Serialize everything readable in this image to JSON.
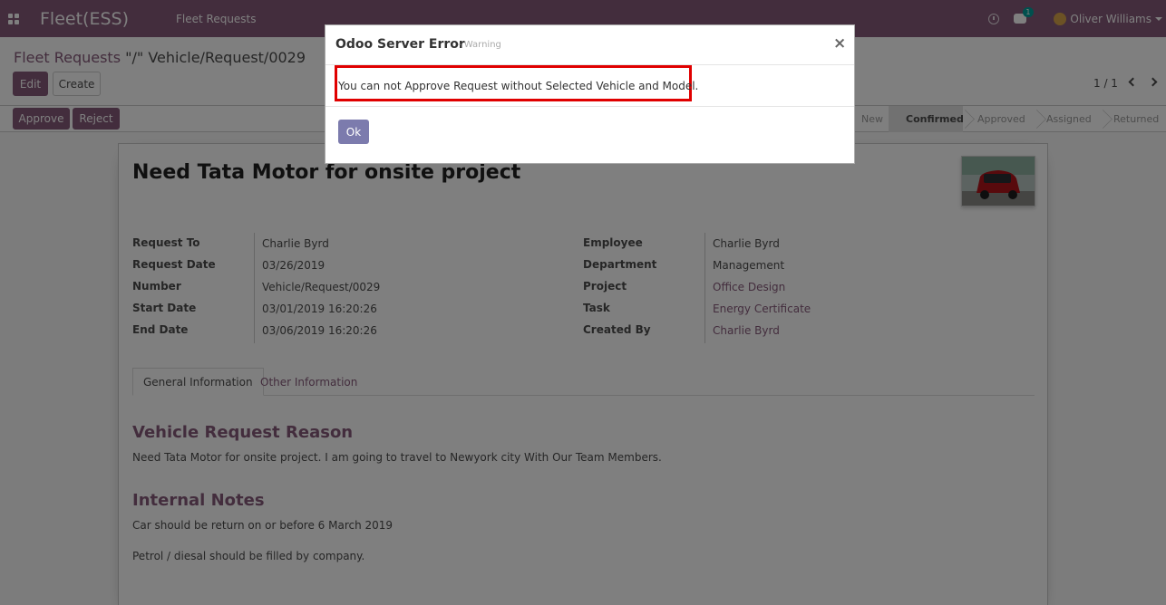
{
  "navbar": {
    "app_title": "Fleet(ESS)",
    "menu_item": "Fleet Requests",
    "chat_count": "1",
    "user_name": "Oliver Williams"
  },
  "control_panel": {
    "breadcrumb_parent": "Fleet Requests",
    "breadcrumb_separator": "\"/\"",
    "breadcrumb_current": "Vehicle/Request/0029",
    "edit_label": "Edit",
    "create_label": "Create",
    "pager": "1 / 1"
  },
  "statusbar": {
    "approve_label": "Approve",
    "reject_label": "Reject",
    "stages": [
      "New",
      "Confirmed",
      "Approved",
      "Assigned",
      "Returned"
    ],
    "active_stage": "Confirmed"
  },
  "form": {
    "title": "Need Tata Motor for onsite project",
    "left_fields": [
      {
        "label": "Request To",
        "value": "Charlie Byrd"
      },
      {
        "label": "Request Date",
        "value": "03/26/2019"
      },
      {
        "label": "Number",
        "value": "Vehicle/Request/0029"
      },
      {
        "label": "Start Date",
        "value": "03/01/2019 16:20:26"
      },
      {
        "label": "End Date",
        "value": "03/06/2019 16:20:26"
      }
    ],
    "right_fields": [
      {
        "label": "Employee",
        "value": "Charlie Byrd"
      },
      {
        "label": "Department",
        "value": "Management"
      },
      {
        "label": "Project",
        "value": "Office Design"
      },
      {
        "label": "Task",
        "value": "Energy Certificate"
      },
      {
        "label": "Created By",
        "value": "Charlie Byrd"
      }
    ],
    "tabs": [
      "General Information",
      "Other Information"
    ],
    "reason_title": "Vehicle Request Reason",
    "reason_text": "Need Tata Motor for onsite project. I am going to travel to Newyork city With Our Team Members.",
    "notes_title": "Internal Notes",
    "notes_line1": "Car should be return on or before 6 March 2019",
    "notes_line2": "Petrol / diesal should be filled by company."
  },
  "dialog": {
    "title": "Odoo Server Error",
    "subtitle": "- Warning",
    "close_symbol": "×",
    "message": "You can not Approve Request without Selected Vehicle and Model.",
    "ok_label": "Ok"
  },
  "colors": {
    "brand": "#875a7b",
    "ok_button": "#7c7bad",
    "highlight": "#e00000"
  }
}
